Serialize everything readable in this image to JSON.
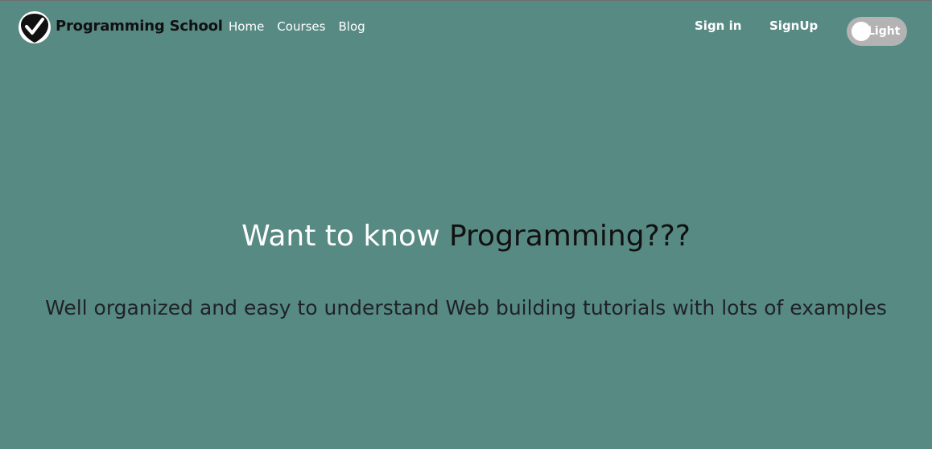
{
  "brand": {
    "name": "Programming School",
    "logo_icon": "checkmark-shield-icon"
  },
  "nav": {
    "links": [
      {
        "label": "Home"
      },
      {
        "label": "Courses"
      },
      {
        "label": "Blog"
      }
    ],
    "sign_in": "Sign in",
    "sign_up": "SignUp",
    "theme_toggle": {
      "label": "Light"
    }
  },
  "hero": {
    "title_part1": "Want to know ",
    "title_part2": "Programming???",
    "subtitle": "Well organized and easy to understand Web building tutorials with lots of examples"
  },
  "colors": {
    "background": "#588a84",
    "toggle_track": "#b3b3b3",
    "heading_dark": "#111111",
    "subtitle_text": "#1e2326"
  }
}
